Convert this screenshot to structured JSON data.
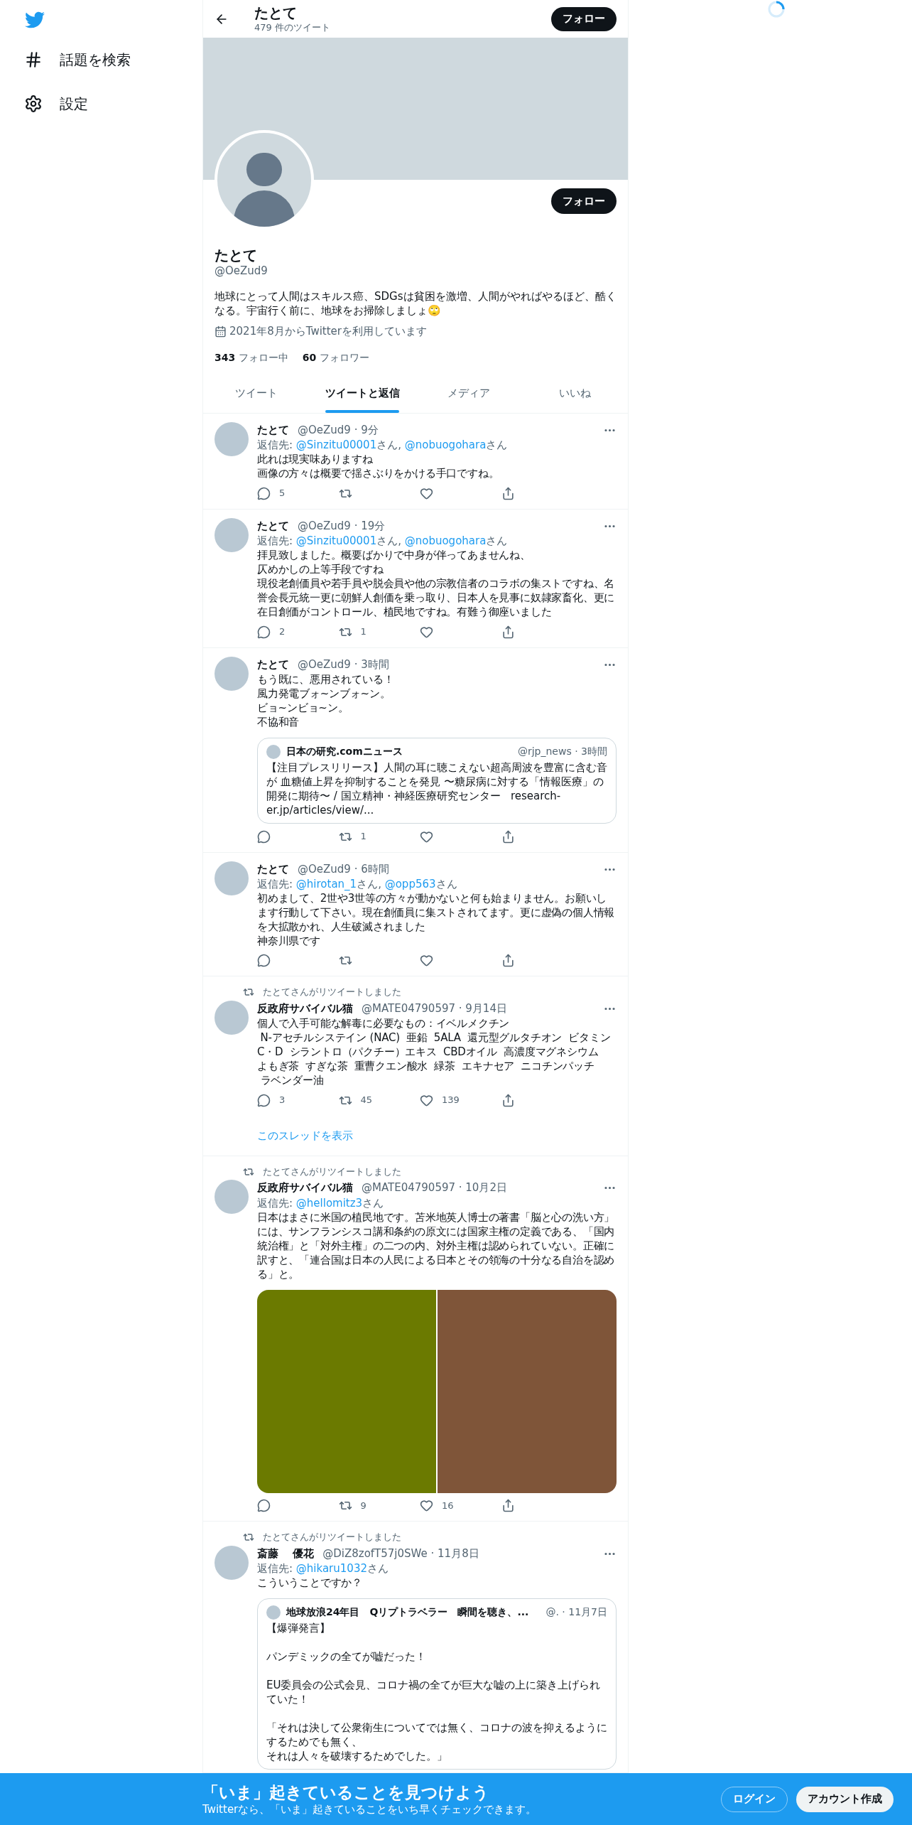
{
  "sidebar": {
    "items": [
      {
        "kind": "hashtag",
        "label": "話題を検索"
      },
      {
        "kind": "settings",
        "label": "設定"
      }
    ]
  },
  "header": {
    "title": "たとて",
    "subtitle": "479 件のツイート",
    "follow_button": "フォロー"
  },
  "profile": {
    "follow_button": "フォロー",
    "name": "たとて",
    "handle": "@OeZud9",
    "bio": "地球にとって人間はスキルス癌、SDGsは貧困を激増、人間がやればやるほど、酷くなる。宇宙行く前に、地球をお掃除しましょ🙄",
    "joined": "2021年8月からTwitterを利用しています",
    "following_count": "343",
    "following_label": "フォロー中",
    "followers_count": "60",
    "followers_label": "フォロワー"
  },
  "tabs": [
    {
      "label": "ツイート",
      "selected": false
    },
    {
      "label": "ツイートと返信",
      "selected": true
    },
    {
      "label": "メディア",
      "selected": false
    },
    {
      "label": "いいね",
      "selected": false
    }
  ],
  "tweets": [
    {
      "name": "たとて",
      "meta": "@OeZud9 · 9分",
      "reply_to": [
        {
          "kind": "plain",
          "text": "返信先: "
        },
        {
          "kind": "link",
          "text": "@Sinzitu00001"
        },
        {
          "kind": "plain",
          "text": "さん, "
        },
        {
          "kind": "link",
          "text": "@nobuogohara"
        },
        {
          "kind": "plain",
          "text": "さん"
        }
      ],
      "lines": [
        "此れは現実味ありますね",
        "画像の方々は概要で揺さぶりをかける手口ですね。"
      ],
      "actions": [
        {
          "kind": "reply",
          "count": "5"
        },
        {
          "kind": "retweet"
        },
        {
          "kind": "like"
        },
        {
          "kind": "share"
        }
      ]
    },
    {
      "name": "たとて",
      "meta": "@OeZud9 · 19分",
      "reply_to": [
        {
          "kind": "plain",
          "text": "返信先: "
        },
        {
          "kind": "link",
          "text": "@Sinzitu00001"
        },
        {
          "kind": "plain",
          "text": "さん, "
        },
        {
          "kind": "link",
          "text": "@nobuogohara"
        },
        {
          "kind": "plain",
          "text": "さん"
        }
      ],
      "lines": [
        "拝見致しました。概要ばかりで中身が伴ってあませんね、",
        "仄めかしの上等手段ですね",
        "現役老創価員や若手員や脱会員や他の宗教信者のコラボの集ストですね、名誉会長元統一更に朝鮮人創価を乗っ取り、日本人を見事に奴隷家畜化、更に在日創価がコントロール、植民地ですね。有難う御座いました"
      ],
      "actions": [
        {
          "kind": "reply",
          "count": "2"
        },
        {
          "kind": "retweet",
          "count": "1"
        },
        {
          "kind": "like"
        },
        {
          "kind": "share"
        }
      ]
    },
    {
      "name": "たとて",
      "meta": "@OeZud9 · 3時間",
      "lines": [
        "もう既に、悪用されている！",
        "風力発電ブォ~ンブォ~ン。",
        "ビョ~ンビョ~ン。",
        "不協和音"
      ],
      "quote": {
        "name": "日本の研究.comニュース",
        "meta": "@rjp_news · 3時間",
        "paragraphs": [
          [
            "【注目プレスリリース】人間の耳に聴こえない超高周波を豊富に含む音が 血糖値上昇を抑制することを発見 〜糖尿病に対する「情報医療」の開発に期待〜 / 国立精神・神経医療研究センター   research-er.jp/articles/view/..."
          ]
        ]
      },
      "actions": [
        {
          "kind": "reply"
        },
        {
          "kind": "retweet",
          "count": "1"
        },
        {
          "kind": "like"
        },
        {
          "kind": "share"
        }
      ]
    },
    {
      "name": "たとて",
      "meta": "@OeZud9 · 6時間",
      "reply_to": [
        {
          "kind": "plain",
          "text": "返信先: "
        },
        {
          "kind": "link",
          "text": "@hirotan_1"
        },
        {
          "kind": "plain",
          "text": "さん, "
        },
        {
          "kind": "link",
          "text": "@opp563"
        },
        {
          "kind": "plain",
          "text": "さん"
        }
      ],
      "lines": [
        "初めまして、2世や3世等の方々が動かないと何も始まりません。お願いします行動して下さい。現在創価員に集ストされてます。更に虚偽の個人情報を大拡散かれ、人生破滅されました",
        "神奈川県です"
      ],
      "actions": [
        {
          "kind": "reply"
        },
        {
          "kind": "retweet"
        },
        {
          "kind": "like"
        },
        {
          "kind": "share"
        }
      ]
    },
    {
      "retweeted_by": "たとてさんがリツイートしました",
      "name": "反政府サバイバル猫",
      "meta": "@MATE04790597 · 9月14日",
      "lines": [
        "個人で入手可能な解毒に必要なもの：イベルメクチン",
        " N-アセチルシステイン (NAC)  亜鉛  5ALA  還元型グルタチオン  ビタミン",
        "C・D  シラントロ（パクチー）エキス  CBDオイル  高濃度マグネシウム",
        "よもぎ茶  すぎな茶  重曹クエン酸水  緑茶  エキナセア  ニコチンパッチ",
        " ラベンダー油"
      ],
      "actions": [
        {
          "kind": "reply",
          "count": "3"
        },
        {
          "kind": "retweet",
          "count": "45"
        },
        {
          "kind": "like",
          "count": "139"
        },
        {
          "kind": "share"
        }
      ],
      "show_thread": "このスレッドを表示"
    },
    {
      "retweeted_by": "たとてさんがリツイートしました",
      "name": "反政府サバイバル猫",
      "meta": "@MATE04790597 · 10月2日",
      "reply_to": [
        {
          "kind": "plain",
          "text": "返信先: "
        },
        {
          "kind": "link",
          "text": "@hellomitz3"
        },
        {
          "kind": "plain",
          "text": "さん"
        }
      ],
      "lines": [
        "日本はまさに米国の植民地です。苫米地英人博士の著書「脳と心の洗い方」には、サンフランシスコ講和条約の原文には国家主権の定義である、「国内統治権」と「対外主権」の二つの内、対外主権は認められていない。正確に訳すと、「連合国は日本の人民による日本とその領海の十分なる自治を認める」と。"
      ],
      "media": [
        {
          "kind": "picture",
          "color": "#6b7a00"
        },
        {
          "kind": "picture",
          "color": "#7f5539"
        }
      ],
      "actions": [
        {
          "kind": "reply"
        },
        {
          "kind": "retweet",
          "count": "9"
        },
        {
          "kind": "like",
          "count": "16"
        },
        {
          "kind": "share"
        }
      ]
    },
    {
      "retweeted_by": "たとてさんがリツイートしました",
      "name": "斎藤　 優花",
      "meta": "@DiZ8zofT57j0SWe · 11月8日",
      "reply_to": [
        {
          "kind": "plain",
          "text": "返信先: "
        },
        {
          "kind": "link",
          "text": "@hikaru1032"
        },
        {
          "kind": "plain",
          "text": "さん"
        }
      ],
      "lines": [
        "こういうことですか？"
      ],
      "quote": {
        "name": "地球放浪24年目　Qリプトラベラー　瞬間を聴き、...",
        "meta": "@. · 11月7日",
        "paragraphs": [
          [
            "【爆弾発言】"
          ],
          [
            "パンデミックの全てが嘘だった！"
          ],
          [
            "EU委員会の公式会見、コロナ禍の全てが巨大な嘘の上に築き上げられていた！"
          ],
          [
            "「それは決して公衆衛生についてでは無く、コロナの波を抑えるようにするためでも無く、",
            "それは人々を破壊するためでした。」"
          ]
        ]
      }
    }
  ],
  "banner": {
    "title": "「いま」起きていることを見つけよう",
    "subtitle": "Twitterなら、「いま」起きていることをいち早くチェックできます。",
    "login_button": "ログイン",
    "signup_button": "アカウント作成"
  }
}
